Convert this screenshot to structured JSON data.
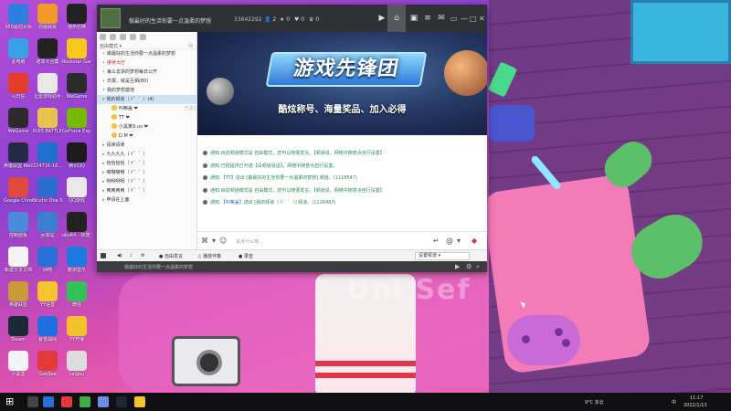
{
  "desktop": {
    "icons": [
      {
        "label": "360驱动大师",
        "color": "#2d7de0"
      },
      {
        "label": "你画我猜",
        "color": "#f19a2a"
      },
      {
        "label": "使命召唤",
        "color": "#222222"
      },
      {
        "label": "此电脑",
        "color": "#3aa0e8"
      },
      {
        "label": "遮罩大合集",
        "color": "#222222"
      },
      {
        "label": "Rockstar Games",
        "color": "#f6c81c"
      },
      {
        "label": "闪日狂",
        "color": "#e53d2a"
      },
      {
        "label": "迅雷游戏助手",
        "color": "#e8e8e8"
      },
      {
        "label": "WeGame",
        "color": "#2b2b2b"
      },
      {
        "label": "WeGame",
        "color": "#2b2b2b"
      },
      {
        "label": "RUIS BATTLEGR…",
        "color": "#e9c24d"
      },
      {
        "label": "GeForce Experience",
        "color": "#76b900"
      },
      {
        "label": "英雄联盟 WeGame版",
        "color": "#222a44"
      },
      {
        "label": "224716-16…",
        "color": "#1e6fd0"
      },
      {
        "label": "腾讯QQ",
        "color": "#1b1b1b"
      },
      {
        "label": "Google Chrome",
        "color": "#e24a3b"
      },
      {
        "label": "Studio One 5",
        "color": "#2a6cd0"
      },
      {
        "label": "QQ游戏",
        "color": "#e8e8e8"
      },
      {
        "label": "控制面板",
        "color": "#4a8ad8"
      },
      {
        "label": "回收站",
        "color": "#3a7fd0"
      },
      {
        "label": "obs64 - 快捷方式",
        "color": "#222222"
      },
      {
        "label": "新建文本文档",
        "color": "#f3f3f3"
      },
      {
        "label": "网吧",
        "color": "#2a6ed8"
      },
      {
        "label": "酷狗音乐",
        "color": "#1a7ae0"
      },
      {
        "label": "英雄联盟",
        "color": "#c99a3a"
      },
      {
        "label": "YY语音",
        "color": "#f4c52e"
      },
      {
        "label": "微信",
        "color": "#34c15a"
      },
      {
        "label": "Steam",
        "color": "#1b2838"
      },
      {
        "label": "暴雪战网",
        "color": "#1f6fe0"
      },
      {
        "label": "YY开播",
        "color": "#f2c22c"
      },
      {
        "label": "小黑盒",
        "color": "#f4f4f4"
      },
      {
        "label": "GeeSee",
        "color": "#e23a3a"
      },
      {
        "label": "caigou",
        "color": "#dcdcdc"
      }
    ]
  },
  "qq": {
    "topbar": {
      "username": "做最好的生活你要一点温柔的梦想",
      "id": "33642292",
      "stats": [
        "2",
        "0",
        "0",
        "0"
      ],
      "icons": [
        "video-icon",
        "home-icon",
        "game-icon",
        "list-icon",
        "mail-icon",
        "skin-icon",
        "minimize-icon",
        "maximize-icon",
        "close-icon"
      ]
    },
    "sidebar": {
      "mode_label": "自由模式",
      "channels": [
        {
          "label": "做最好的生活你要一点温柔的梦想",
          "style": "normal"
        },
        {
          "label": "接待大厅",
          "style": "red"
        },
        {
          "label": "每么去讲的梦想每日公开",
          "style": "normal"
        },
        {
          "label": "日报、就是互相(80)",
          "style": "normal"
        },
        {
          "label": "我的梦想基地",
          "style": "normal"
        },
        {
          "label": "我的频道（ゞ゛゛）(4)",
          "style": "selected"
        },
        {
          "label": "叫嘛盖 ❤",
          "style": "sub"
        },
        {
          "label": "TT ❤",
          "style": "sub"
        },
        {
          "label": "小黑某9.un ❤",
          "style": "sub"
        },
        {
          "label": "D.M ❤",
          "style": "sub"
        },
        {
          "label": "请读请读",
          "style": "collapsed"
        },
        {
          "label": "九九九九（ゞ゛゛）",
          "style": "collapsed"
        },
        {
          "label": "恰恰恰恰（ゞ゛゛）",
          "style": "collapsed"
        },
        {
          "label": "嘟嘟嘟嘟（ゞ゛゛）",
          "style": "collapsed"
        },
        {
          "label": "咧咧咧咧（ゞ゛゛）",
          "style": "collapsed"
        },
        {
          "label": "两两两两（ゞ゛゛）",
          "style": "collapsed"
        },
        {
          "label": "申请在上面",
          "style": "collapsed"
        }
      ],
      "sub_tag": "已关注"
    },
    "banner": {
      "title": "游戏先锋团",
      "subtitle": "酷炫称号、海量奖品、加入必得"
    },
    "messages": [
      {
        "prefix": "通知:",
        "text": "目前频道模式是 自由模式，您可以随便发言。【频道说、网络中随意点自行设置】"
      },
      {
        "prefix": "通知:",
        "text": "已经提供已开通【白频道说话】，网络中随意点自行设置。"
      },
      {
        "prefix": "通知:",
        "user": "【TT】",
        "text": "进出 [做最好的生活你要一点温柔的梦想] 频道。(1118547)"
      },
      {
        "prefix": "通知:",
        "text": "目前频道模式是 自由模式，您可以随便发言。【频道说、网络中随意点自行设置】"
      },
      {
        "prefix": "通知:",
        "user": "【叫嘛盖】",
        "text": "进出 [我的频道（ゞ゛゛）] 频道。(1116487)"
      }
    ],
    "input": {
      "placeholder": "说点什么吧..."
    },
    "footer": {
      "free_speak": "自由发言",
      "music": "播放伴奏",
      "record": "录音",
      "settings": "设置频道"
    },
    "bottom": {
      "text": "做最好的生活你要一点温柔的梦想"
    }
  },
  "taskbar": {
    "weather": "9°C 多云",
    "time": "11:17",
    "date": "2022/1/13",
    "ime": "中"
  },
  "wallpaper": {
    "text": "Uni  Sef"
  }
}
